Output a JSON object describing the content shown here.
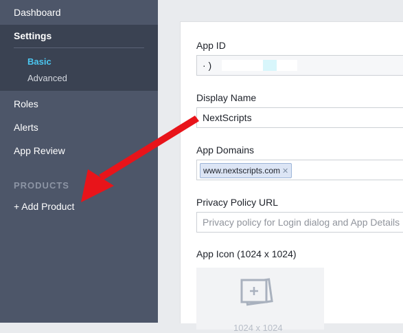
{
  "sidebar": {
    "dashboard": "Dashboard",
    "settings": "Settings",
    "basic": "Basic",
    "advanced": "Advanced",
    "roles": "Roles",
    "alerts": "Alerts",
    "app_review": "App Review",
    "products_header": "PRODUCTS",
    "add_product": "+ Add Product"
  },
  "form": {
    "app_id_label": "App ID",
    "app_id_value": "·                    )",
    "display_name_label": "Display Name",
    "display_name_value": "NextScripts",
    "app_domains_label": "App Domains",
    "app_domain_token": "www.nextscripts.com",
    "token_remove": "✕",
    "privacy_label": "Privacy Policy URL",
    "privacy_placeholder": "Privacy policy for Login dialog and App Details",
    "app_icon_label": "App Icon (1024 x 1024)",
    "app_icon_caption": "1024 x 1024"
  },
  "colors": {
    "sidebar_bg": "#4d5669",
    "active_accent": "#4bc6f0",
    "arrow": "#e8141a"
  }
}
